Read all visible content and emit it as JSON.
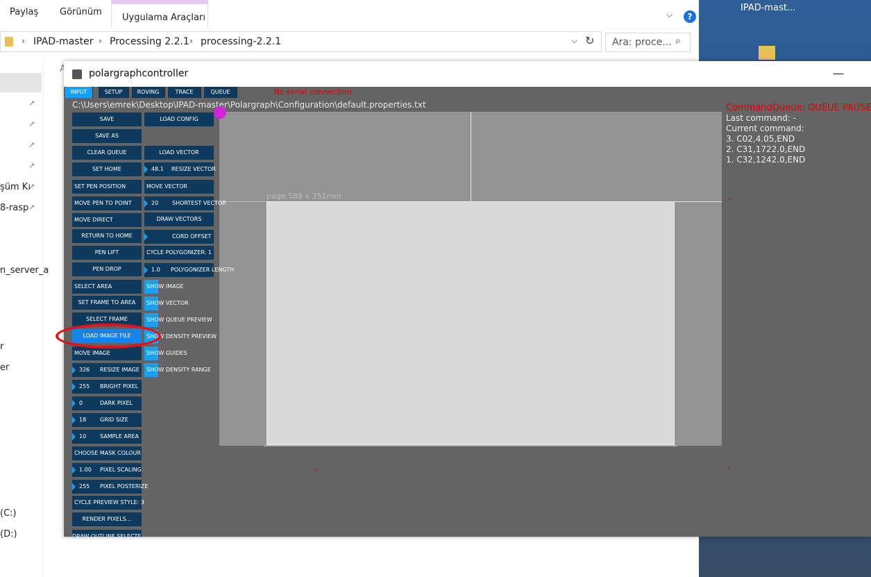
{
  "explorer": {
    "ribbon_tabs": [
      "Paylaş",
      "Görünüm",
      "Uygulama Araçları"
    ],
    "breadcrumbs": [
      "IPAD-master",
      "Processing 2.2.1",
      "processing-2.2.1"
    ],
    "search_placeholder": "Ara: proce...",
    "nav_fragments": [
      "şüm Kı",
      "8-rasp",
      "n_server_a",
      "r",
      "er",
      "(C:)",
      "(D:)",
      "A"
    ],
    "help_label": "?"
  },
  "desktop": {
    "icon_label": "IPAD-mast..."
  },
  "app": {
    "title": "polargraphcontroller",
    "minimize": "—",
    "tabs": [
      "INPUT",
      "SETUP",
      "ROVING",
      "TRACE",
      "QUEUE"
    ],
    "serial_status": "No serial connection.",
    "config_path": "C:\\Users\\emrek\\Desktop\\IPAD-master\\Polargraph\\Configuration\\default.properties.txt",
    "left_buttons": {
      "save": "SAVE",
      "save_as": "SAVE AS",
      "clear_queue": "CLEAR QUEUE",
      "set_home": "SET HOME",
      "set_pen_position": "SET PEN POSITION",
      "move_pen_to_point": "MOVE PEN TO POINT",
      "move_direct": "MOVE DIRECT",
      "return_to_home": "RETURN TO HOME",
      "pen_lift": "PEN LIFT",
      "pen_drop": "PEN DROP",
      "select_area": "SELECT AREA",
      "set_frame_to_area": "SET FRAME TO AREA",
      "select_frame": "SELECT FRAME",
      "load_image_file": "LOAD IMAGE FILE",
      "move_image": "MOVE IMAGE",
      "choose_mask_colour": "CHOOSE MASK COLOUR",
      "cycle_preview_style": "CYCLE PREVIEW STYLE: 3",
      "render_pixels": "RENDER PIXELS...",
      "draw_outline_selected": "DRAW OUTLINE SELECTED"
    },
    "left_numeric": [
      {
        "value": "326",
        "label": "RESIZE IMAGE"
      },
      {
        "value": "255",
        "label": "BRIGHT PIXEL"
      },
      {
        "value": "0",
        "label": "DARK PIXEL"
      },
      {
        "value": "18",
        "label": "GRID SIZE"
      },
      {
        "value": "10",
        "label": "SAMPLE AREA"
      },
      {
        "value": "1.00",
        "label": "PIXEL SCALING"
      },
      {
        "value": "255",
        "label": "PIXEL POSTERIZE"
      }
    ],
    "right_buttons": {
      "load_config": "LOAD CONFIG",
      "load_vector": "LOAD VECTOR",
      "move_vector": "MOVE VECTOR",
      "draw_vectors": "DRAW VECTORS",
      "cycle_polygonizer": "CYCLE POLYGONIZER: 1"
    },
    "right_numeric": [
      {
        "value": "48.1",
        "label": "RESIZE VECTOR"
      },
      {
        "value": "20",
        "label": "SHORTEST VECTOR"
      },
      {
        "value": "",
        "label": "CORD OFFSET"
      },
      {
        "value": "1.0",
        "label": "POLYGONIZER LENGTH"
      }
    ],
    "toggles": [
      "SHOW IMAGE",
      "SHOW VECTOR",
      "SHOW QUEUE PREVIEW",
      "SHOW DENSITY PREVIEW",
      "SHOW GUIDES",
      "SHOW DENSITY RANGE"
    ],
    "page_label": "page 588 x 351mm",
    "command_queue": {
      "title": "CommandQueue: QUEUE PAUSED",
      "last": "Last command: -",
      "current": "Current command:",
      "items": [
        "3. C02,4.05,END",
        "2. C31,1722.0,END",
        "1. C32,1242.0,END"
      ]
    }
  }
}
